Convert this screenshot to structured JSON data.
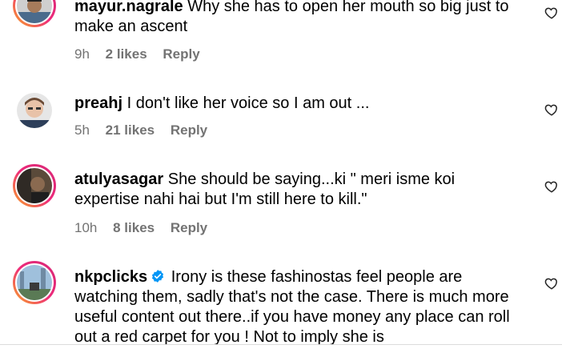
{
  "comments": [
    {
      "username": "mayur.nagrale",
      "text": "Why she has to open her mouth so big just to make an ascent",
      "time": "9h",
      "likes": "2 likes",
      "reply": "Reply",
      "verified": false
    },
    {
      "username": "preahj",
      "text": "I don't like her voice so I am out ...",
      "time": "5h",
      "likes": "21 likes",
      "reply": "Reply",
      "verified": false
    },
    {
      "username": "atulyasagar",
      "text": "She should be saying...ki \" meri isme koi expertise nahi hai but I'm still here to kill.\"",
      "time": "10h",
      "likes": "8 likes",
      "reply": "Reply",
      "verified": false
    },
    {
      "username": "nkpclicks",
      "text": "Irony is these fashinostas feel people are watching them, sadly that's not the case. There is much more useful content out there..if you have money any place can roll out a red carpet for you ! Not to imply she is",
      "verified": true
    }
  ],
  "colors": {
    "meta": "#737373",
    "verified": "#0095f6",
    "story_ring": [
      "#f9a825",
      "#ee2a7b"
    ]
  },
  "icons": {
    "like": "heart-icon",
    "verified": "verified-badge-icon"
  }
}
